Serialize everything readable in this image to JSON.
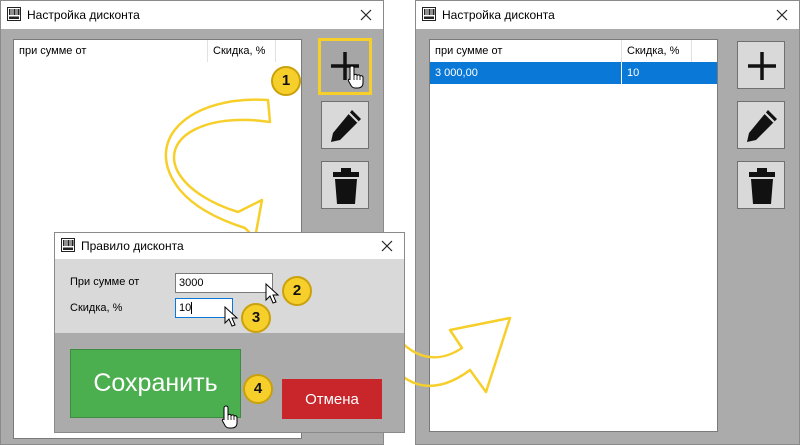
{
  "left_window": {
    "title": "Настройка дисконта",
    "columns": [
      "при сумме от",
      "Скидка, %"
    ],
    "buttons": {
      "add_icon": "plus-icon",
      "edit_icon": "pencil-icon",
      "delete_icon": "trash-icon"
    }
  },
  "right_window": {
    "title": "Настройка дисконта",
    "columns": [
      "при сумме от",
      "Скидка, %"
    ],
    "rows": [
      {
        "min_sum": "3 000,00",
        "discount": "10"
      }
    ]
  },
  "dialog": {
    "title": "Правило дисконта",
    "sum_label": "При сумме от",
    "sum_value": "3000",
    "discount_label": "Скидка, %",
    "discount_value": "10",
    "save_label": "Сохранить",
    "cancel_label": "Отмена"
  },
  "steps": [
    "1",
    "2",
    "3",
    "4"
  ],
  "colors": {
    "highlight": "#f6cf2b",
    "selection": "#0a78d7",
    "save": "#4bae4f",
    "cancel": "#c9262b"
  }
}
